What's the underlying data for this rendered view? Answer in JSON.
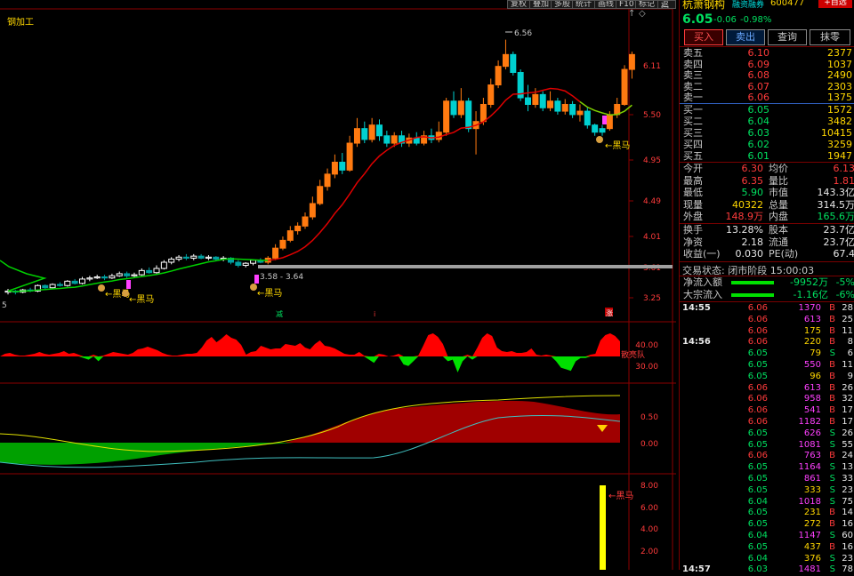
{
  "toolbar": {
    "buttons": [
      "复权",
      "叠加",
      "多股",
      "统计",
      "画线",
      "F10",
      "标记",
      "返回"
    ],
    "small_icons": [
      "↑",
      "◇"
    ]
  },
  "chart": {
    "stock_label": "钢加工",
    "high_label": "6.56",
    "range_label": "3.58 - 3.64",
    "price_axis": [
      "6.11",
      "5.50",
      "4.95",
      "4.49",
      "4.01",
      "3.61",
      "3.25"
    ],
    "left_edge_label": "5",
    "signal_labels": [
      "←黑马",
      "←黑马",
      "←黑马",
      "←黑马"
    ],
    "markers": [
      "减",
      "i",
      "涨"
    ],
    "panel2_axis": [
      "40.00",
      "30.00"
    ],
    "panel2_tag": "散亮队",
    "panel3_axis": [
      "0.50",
      "0.00"
    ],
    "panel4_axis": [
      "8.00",
      "6.00",
      "4.00",
      "2.00"
    ],
    "panel4_tag": "←黑马"
  },
  "quote": {
    "name": "杭萧钢构",
    "tag": "融资融券",
    "code": "600477",
    "self_select": "+自选",
    "price": "6.05",
    "change": "-0.06",
    "change_pct": "-0.98%",
    "actions": [
      "买入",
      "卖出",
      "查询",
      "抹零"
    ],
    "asks": [
      {
        "label": "卖五",
        "price": "6.10",
        "vol": "2377"
      },
      {
        "label": "卖四",
        "price": "6.09",
        "vol": "1037"
      },
      {
        "label": "卖三",
        "price": "6.08",
        "vol": "2490"
      },
      {
        "label": "卖二",
        "price": "6.07",
        "vol": "2303"
      },
      {
        "label": "卖一",
        "price": "6.06",
        "vol": "1375"
      }
    ],
    "bids": [
      {
        "label": "买一",
        "price": "6.05",
        "vol": "1572"
      },
      {
        "label": "买二",
        "price": "6.04",
        "vol": "3482"
      },
      {
        "label": "买三",
        "price": "6.03",
        "vol": "10415"
      },
      {
        "label": "买四",
        "price": "6.02",
        "vol": "3259"
      },
      {
        "label": "买五",
        "price": "6.01",
        "vol": "1947"
      }
    ],
    "stats": [
      {
        "l1": "今开",
        "v1": "6.30",
        "l2": "均价",
        "v2": "6.13"
      },
      {
        "l1": "最高",
        "v1": "6.35",
        "l2": "量比",
        "v2": "1.81"
      },
      {
        "l1": "最低",
        "v1": "5.90",
        "l2": "市值",
        "v2": "143.3亿"
      },
      {
        "l1": "现量",
        "v1": "40322",
        "l2": "总量",
        "v2": "314.5万"
      },
      {
        "l1": "外盘",
        "v1": "148.9万",
        "l2": "内盘",
        "v2": "165.6万"
      }
    ],
    "stats2": [
      {
        "l1": "换手",
        "v1": "13.28%",
        "l2": "股本",
        "v2": "23.7亿"
      },
      {
        "l1": "净资",
        "v1": "2.18",
        "l2": "流通",
        "v2": "23.7亿"
      },
      {
        "l1": "收益(一)",
        "v1": "0.030",
        "l2": "PE(动)",
        "v2": "67.4"
      }
    ],
    "trade_status": "交易状态: 闭市阶段 15:00:03",
    "flows": [
      {
        "label": "净流入额",
        "value": "-9952万",
        "pct": "-5%"
      },
      {
        "label": "大宗流入",
        "value": "-1.16亿",
        "pct": "-6%"
      }
    ]
  },
  "ticks": [
    {
      "time": "14:55",
      "price": "6.06",
      "vol": "1370",
      "bs": "B",
      "n": "28"
    },
    {
      "time": "",
      "price": "6.06",
      "vol": "613",
      "bs": "B",
      "n": "25"
    },
    {
      "time": "",
      "price": "6.06",
      "vol": "175",
      "bs": "B",
      "n": "11"
    },
    {
      "time": "14:56",
      "price": "6.06",
      "vol": "220",
      "bs": "B",
      "n": "8"
    },
    {
      "time": "",
      "price": "6.05",
      "vol": "79",
      "bs": "S",
      "n": "6"
    },
    {
      "time": "",
      "price": "6.05",
      "vol": "550",
      "bs": "B",
      "n": "11"
    },
    {
      "time": "",
      "price": "6.05",
      "vol": "96",
      "bs": "B",
      "n": "9"
    },
    {
      "time": "",
      "price": "6.06",
      "vol": "613",
      "bs": "B",
      "n": "26"
    },
    {
      "time": "",
      "price": "6.06",
      "vol": "958",
      "bs": "B",
      "n": "32"
    },
    {
      "time": "",
      "price": "6.06",
      "vol": "541",
      "bs": "B",
      "n": "17"
    },
    {
      "time": "",
      "price": "6.06",
      "vol": "1182",
      "bs": "B",
      "n": "17"
    },
    {
      "time": "",
      "price": "6.05",
      "vol": "626",
      "bs": "S",
      "n": "26"
    },
    {
      "time": "",
      "price": "6.05",
      "vol": "1081",
      "bs": "S",
      "n": "55"
    },
    {
      "time": "",
      "price": "6.06",
      "vol": "763",
      "bs": "B",
      "n": "24"
    },
    {
      "time": "",
      "price": "6.05",
      "vol": "1164",
      "bs": "S",
      "n": "13"
    },
    {
      "time": "",
      "price": "6.05",
      "vol": "861",
      "bs": "S",
      "n": "33"
    },
    {
      "time": "",
      "price": "6.05",
      "vol": "333",
      "bs": "S",
      "n": "23"
    },
    {
      "time": "",
      "price": "6.04",
      "vol": "1018",
      "bs": "S",
      "n": "75"
    },
    {
      "time": "",
      "price": "6.05",
      "vol": "231",
      "bs": "B",
      "n": "14"
    },
    {
      "time": "",
      "price": "6.05",
      "vol": "272",
      "bs": "B",
      "n": "16"
    },
    {
      "time": "",
      "price": "6.04",
      "vol": "1147",
      "bs": "S",
      "n": "60"
    },
    {
      "time": "",
      "price": "6.05",
      "vol": "437",
      "bs": "B",
      "n": "16"
    },
    {
      "time": "",
      "price": "6.04",
      "vol": "376",
      "bs": "S",
      "n": "23"
    },
    {
      "time": "14:57",
      "price": "6.03",
      "vol": "1481",
      "bs": "S",
      "n": "78"
    }
  ],
  "colors": {
    "up": "#ff3b3b",
    "down": "#00e060",
    "candle_up": "#ff7a10",
    "ma": "#e00000",
    "ma_green": "#00d000"
  }
}
